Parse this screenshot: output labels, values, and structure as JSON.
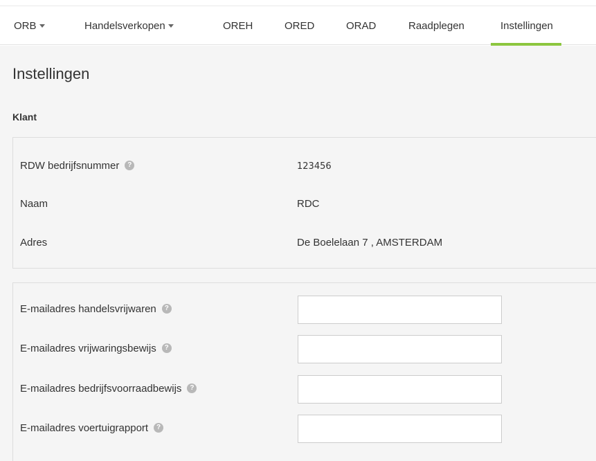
{
  "nav": {
    "items": [
      {
        "label": "ORB",
        "dropdown": true
      },
      {
        "label": "Handelsverkopen",
        "dropdown": true
      },
      {
        "label": "OREH",
        "dropdown": false
      },
      {
        "label": "ORED",
        "dropdown": false
      },
      {
        "label": "ORAD",
        "dropdown": false
      },
      {
        "label": "Raadplegen",
        "dropdown": false
      },
      {
        "label": "Instellingen",
        "dropdown": false,
        "active": true
      }
    ],
    "active_color": "#8cc63f"
  },
  "page": {
    "title": "Instellingen",
    "section_title": "Klant"
  },
  "customer": {
    "rdw_label": "RDW bedrijfsnummer",
    "rdw_value": "123456",
    "name_label": "Naam",
    "name_value": "RDC",
    "address_label": "Adres",
    "address_value": "De Boelelaan 7 , AMSTERDAM"
  },
  "emails": {
    "fields": [
      {
        "label": "E-mailadres handelsvrijwaren",
        "value": ""
      },
      {
        "label": "E-mailadres vrijwaringsbewijs",
        "value": ""
      },
      {
        "label": "E-mailadres bedrijfsvoorraadbewijs",
        "value": ""
      },
      {
        "label": "E-mailadres voertuigrapport",
        "value": ""
      }
    ]
  },
  "icons": {
    "help": "question-circle-icon",
    "caret": "caret-down-icon"
  }
}
